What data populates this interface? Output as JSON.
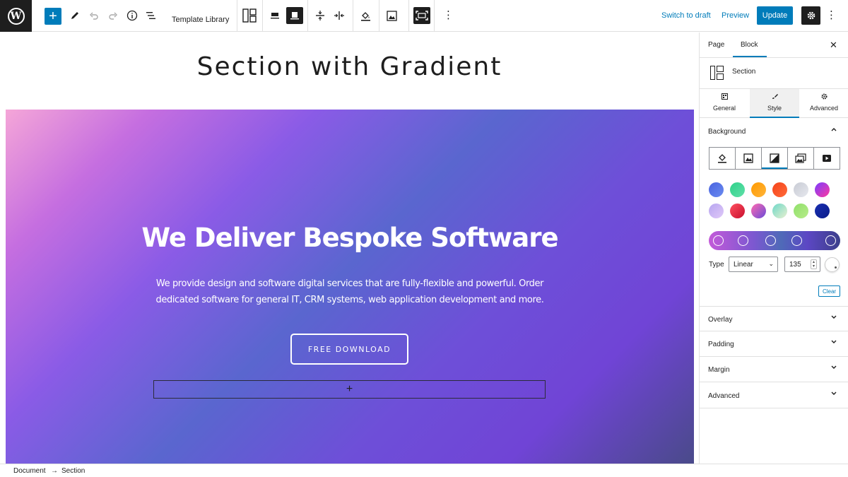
{
  "toolbar": {
    "logo_glyph": "W",
    "add_glyph": "+",
    "template_library": "Template Library",
    "switch_to_draft": "Switch to draft",
    "preview": "Preview",
    "update": "Update",
    "more_glyph": "⋮",
    "icons": [
      "add-block-icon",
      "edit-tools-icon",
      "undo-icon",
      "redo-icon",
      "info-icon",
      "list-view-icon",
      "layout-icon",
      "align-icon",
      "full-width-icon",
      "vertical-align-icon",
      "horizontal-align-icon",
      "fill-icon",
      "image-icon",
      "fullscreen-icon",
      "more-icon",
      "settings-gear-icon"
    ]
  },
  "canvas": {
    "page_title": "Section with Gradient",
    "hero_title": "We Deliver Bespoke Software",
    "hero_text": "We provide design and software digital services that are fully-flexible and powerful. Order dedicated software for general IT, CRM systems, web application development and more.",
    "cta_label": "FREE DOWNLOAD",
    "appender_glyph": "+"
  },
  "breadcrumb": {
    "items": [
      "Document",
      "Section"
    ],
    "separator": "→"
  },
  "sidebar": {
    "tabs": [
      "Page",
      "Block"
    ],
    "active_tab": "Block",
    "close_glyph": "✕",
    "block_name": "Section",
    "style_tabs": [
      {
        "label": "General",
        "icon": "general-icon"
      },
      {
        "label": "Style",
        "icon": "brush-icon"
      },
      {
        "label": "Advanced",
        "icon": "gear-icon"
      }
    ],
    "active_style_tab": "Style",
    "background": {
      "label": "Background",
      "type_icons": [
        "paint-bucket-icon",
        "image-icon",
        "gradient-icon",
        "gallery-icon",
        "video-icon"
      ],
      "active_type": "gradient-icon",
      "presets": [
        {
          "from": "#4a63e0",
          "to": "#6a8cf0"
        },
        {
          "from": "#2fd08a",
          "to": "#5fe0a8"
        },
        {
          "from": "#ff9a00",
          "to": "#ffb43a"
        },
        {
          "from": "#f5441a",
          "to": "#ff6a3a"
        },
        {
          "from": "#c8cbd4",
          "to": "#e6e8ee"
        },
        {
          "from": "#7a3cff",
          "to": "#ff3aa0"
        },
        {
          "from": "#b7a6f0",
          "to": "#e0c8f8"
        },
        {
          "from": "#ff5060",
          "to": "#c8102e"
        },
        {
          "from": "#ff6ab0",
          "to": "#6a4cd8"
        },
        {
          "from": "#6fd8c8",
          "to": "#e8f0d0"
        },
        {
          "from": "#8fe06a",
          "to": "#b8ec8a"
        },
        {
          "from": "#1a2fb0",
          "to": "#0a1c8a"
        }
      ],
      "gradient_stops": 5,
      "type_label": "Type",
      "type_value": "Linear",
      "angle_value": "135",
      "clear_label": "Clear"
    },
    "panels": [
      "Overlay",
      "Padding",
      "Margin",
      "Advanced"
    ],
    "chevron_down": "⌄",
    "chevron_up": "⌃"
  },
  "colors": {
    "accent": "#007cba",
    "dark": "#1e1e1e",
    "border": "#e0e0e0"
  }
}
